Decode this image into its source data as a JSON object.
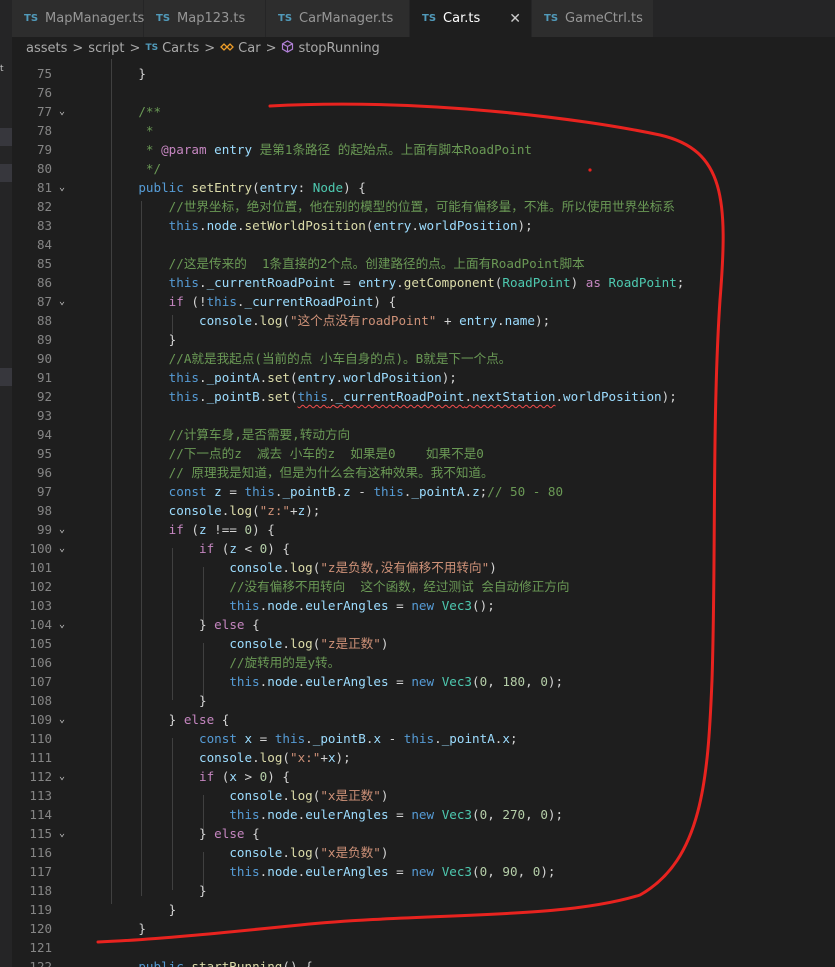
{
  "tabs": [
    {
      "badge": "TS",
      "name": "MapManager.ts"
    },
    {
      "badge": "TS",
      "name": "Map123.ts"
    },
    {
      "badge": "TS",
      "name": "CarManager.ts"
    },
    {
      "badge": "TS",
      "name": "Car.ts",
      "close": "✕"
    },
    {
      "badge": "TS",
      "name": "GameCtrl.ts"
    }
  ],
  "sidebar_letter": "t",
  "breadcrumb": {
    "folder1": "assets",
    "folder2": "script",
    "badge": "TS",
    "file": "Car.ts",
    "class_icon": "class-icon",
    "class": "Car",
    "method_icon": "method-icon",
    "method": "stopRunning",
    "separator": ">"
  },
  "lines": [
    {
      "n": "75",
      "fold": "",
      "tokens": [
        [
          "",
          "    }"
        ]
      ]
    },
    {
      "n": "76",
      "fold": "",
      "tokens": [
        [
          "",
          ""
        ]
      ]
    },
    {
      "n": "77",
      "fold": "⌄",
      "tokens": [
        [
          "cm",
          "    /**"
        ]
      ]
    },
    {
      "n": "78",
      "fold": "",
      "tokens": [
        [
          "cm",
          "     *"
        ]
      ]
    },
    {
      "n": "79",
      "fold": "",
      "tokens": [
        [
          "cm",
          "     * "
        ],
        [
          "ctl",
          "@param"
        ],
        [
          "cm",
          " "
        ],
        [
          "pr",
          "entry"
        ],
        [
          "cm",
          " 是第1条路径 的起始点。上面有脚本RoadPoint"
        ]
      ]
    },
    {
      "n": "80",
      "fold": "",
      "tokens": [
        [
          "cm",
          "     */"
        ]
      ]
    },
    {
      "n": "81",
      "fold": "⌄",
      "tokens": [
        [
          "kw",
          "    public "
        ],
        [
          "fn",
          "setEntry"
        ],
        [
          "",
          "("
        ],
        [
          "pr",
          "entry"
        ],
        [
          "",
          ": "
        ],
        [
          "ty",
          "Node"
        ],
        [
          "",
          ") {"
        ]
      ]
    },
    {
      "n": "82",
      "fold": "",
      "tokens": [
        [
          "cm",
          "        //世界坐标，绝对位置，他在别的模型的位置，可能有偏移量，不准。所以使用世界坐标系"
        ]
      ]
    },
    {
      "n": "83",
      "fold": "",
      "tokens": [
        [
          "kw",
          "        this"
        ],
        [
          "",
          "."
        ],
        [
          "pr",
          "node"
        ],
        [
          "",
          "."
        ],
        [
          "fn",
          "setWorldPosition"
        ],
        [
          "",
          "("
        ],
        [
          "pr",
          "entry"
        ],
        [
          "",
          "."
        ],
        [
          "pr",
          "worldPosition"
        ],
        [
          "",
          ");"
        ]
      ]
    },
    {
      "n": "84",
      "fold": "",
      "tokens": [
        [
          "",
          ""
        ]
      ]
    },
    {
      "n": "85",
      "fold": "",
      "tokens": [
        [
          "cm",
          "        //这是传来的  1条直接的2个点。创建路径的点。上面有RoadPoint脚本"
        ]
      ]
    },
    {
      "n": "86",
      "fold": "",
      "tokens": [
        [
          "kw",
          "        this"
        ],
        [
          "",
          "."
        ],
        [
          "pr",
          "_currentRoadPoint"
        ],
        [
          "",
          " = "
        ],
        [
          "pr",
          "entry"
        ],
        [
          "",
          "."
        ],
        [
          "fn",
          "getComponent"
        ],
        [
          "",
          "("
        ],
        [
          "ty",
          "RoadPoint"
        ],
        [
          "",
          ") "
        ],
        [
          "ctl",
          "as"
        ],
        [
          "",
          " "
        ],
        [
          "ty",
          "RoadPoint"
        ],
        [
          "",
          ";"
        ]
      ]
    },
    {
      "n": "87",
      "fold": "⌄",
      "tokens": [
        [
          "ctl",
          "        if"
        ],
        [
          "",
          " (!"
        ],
        [
          "kw",
          "this"
        ],
        [
          "",
          "."
        ],
        [
          "pr",
          "_currentRoadPoint"
        ],
        [
          "",
          ") {"
        ]
      ]
    },
    {
      "n": "88",
      "fold": "",
      "tokens": [
        [
          "pr",
          "            console"
        ],
        [
          "",
          "."
        ],
        [
          "fn",
          "log"
        ],
        [
          "",
          "("
        ],
        [
          "st",
          "\"这个点没有roadPoint\""
        ],
        [
          "",
          " + "
        ],
        [
          "pr",
          "entry"
        ],
        [
          "",
          "."
        ],
        [
          "pr",
          "name"
        ],
        [
          "",
          ");"
        ]
      ]
    },
    {
      "n": "89",
      "fold": "",
      "tokens": [
        [
          "",
          "        }"
        ]
      ]
    },
    {
      "n": "90",
      "fold": "",
      "tokens": [
        [
          "cm",
          "        //A就是我起点(当前的点 小车自身的点)。B就是下一个点。"
        ]
      ]
    },
    {
      "n": "91",
      "fold": "",
      "tokens": [
        [
          "kw",
          "        this"
        ],
        [
          "",
          "."
        ],
        [
          "pr",
          "_pointA"
        ],
        [
          "",
          "."
        ],
        [
          "fn",
          "set"
        ],
        [
          "",
          "("
        ],
        [
          "pr",
          "entry"
        ],
        [
          "",
          "."
        ],
        [
          "pr",
          "worldPosition"
        ],
        [
          "",
          ");"
        ]
      ]
    },
    {
      "n": "92",
      "fold": "",
      "tokens": [
        [
          "kw",
          "        this"
        ],
        [
          "",
          "."
        ],
        [
          "pr",
          "_pointB"
        ],
        [
          "",
          "."
        ],
        [
          "fn",
          "set"
        ],
        [
          "",
          "("
        ],
        [
          "kw",
          "this",
          "squig"
        ],
        [
          "",
          ".",
          "squig"
        ],
        [
          "pr",
          "_currentRoadPoint",
          "squig"
        ],
        [
          "",
          ".",
          "squig"
        ],
        [
          "pr",
          "nextStation",
          "squig"
        ],
        [
          "",
          "."
        ],
        [
          "pr",
          "worldPosition"
        ],
        [
          "",
          ");"
        ]
      ]
    },
    {
      "n": "93",
      "fold": "",
      "tokens": [
        [
          "",
          ""
        ]
      ]
    },
    {
      "n": "94",
      "fold": "",
      "tokens": [
        [
          "cm",
          "        //计算车身,是否需要,转动方向"
        ]
      ]
    },
    {
      "n": "95",
      "fold": "",
      "tokens": [
        [
          "cm",
          "        //下一点的z  减去 小车的z  如果是0    如果不是0"
        ]
      ]
    },
    {
      "n": "96",
      "fold": "",
      "tokens": [
        [
          "cm",
          "        // 原理我是知道，但是为什么会有这种效果。我不知道。"
        ]
      ]
    },
    {
      "n": "97",
      "fold": "",
      "tokens": [
        [
          "kw",
          "        const "
        ],
        [
          "pr",
          "z"
        ],
        [
          "",
          " = "
        ],
        [
          "kw",
          "this"
        ],
        [
          "",
          "."
        ],
        [
          "pr",
          "_pointB"
        ],
        [
          "",
          "."
        ],
        [
          "pr",
          "z"
        ],
        [
          "",
          " - "
        ],
        [
          "kw",
          "this"
        ],
        [
          "",
          "."
        ],
        [
          "pr",
          "_pointA"
        ],
        [
          "",
          "."
        ],
        [
          "pr",
          "z"
        ],
        [
          "",
          ";"
        ],
        [
          "cm",
          "// 50 - 80"
        ]
      ]
    },
    {
      "n": "98",
      "fold": "",
      "tokens": [
        [
          "pr",
          "        console"
        ],
        [
          "",
          "."
        ],
        [
          "fn",
          "log"
        ],
        [
          "",
          "("
        ],
        [
          "st",
          "\"z:\""
        ],
        [
          "",
          "+"
        ],
        [
          "pr",
          "z"
        ],
        [
          "",
          ");"
        ]
      ]
    },
    {
      "n": "99",
      "fold": "⌄",
      "tokens": [
        [
          "ctl",
          "        if"
        ],
        [
          "",
          " ("
        ],
        [
          "pr",
          "z"
        ],
        [
          "",
          " !== "
        ],
        [
          "nu",
          "0"
        ],
        [
          "",
          ") {"
        ]
      ]
    },
    {
      "n": "100",
      "fold": "⌄",
      "tokens": [
        [
          "ctl",
          "            if"
        ],
        [
          "",
          " ("
        ],
        [
          "pr",
          "z"
        ],
        [
          "",
          " < "
        ],
        [
          "nu",
          "0"
        ],
        [
          "",
          ") {"
        ]
      ]
    },
    {
      "n": "101",
      "fold": "",
      "tokens": [
        [
          "pr",
          "                console"
        ],
        [
          "",
          "."
        ],
        [
          "fn",
          "log"
        ],
        [
          "",
          "("
        ],
        [
          "st",
          "\"z是负数,没有偏移不用转向\""
        ],
        [
          "",
          ")"
        ]
      ]
    },
    {
      "n": "102",
      "fold": "",
      "tokens": [
        [
          "cm",
          "                //没有偏移不用转向  这个函数，经过测试 会自动修正方向"
        ]
      ]
    },
    {
      "n": "103",
      "fold": "",
      "tokens": [
        [
          "kw",
          "                this"
        ],
        [
          "",
          "."
        ],
        [
          "pr",
          "node"
        ],
        [
          "",
          "."
        ],
        [
          "pr",
          "eulerAngles"
        ],
        [
          "",
          " = "
        ],
        [
          "kw",
          "new "
        ],
        [
          "ty",
          "Vec3"
        ],
        [
          "",
          "();"
        ]
      ]
    },
    {
      "n": "104",
      "fold": "⌄",
      "tokens": [
        [
          "",
          "            } "
        ],
        [
          "ctl",
          "else"
        ],
        [
          "",
          " {"
        ]
      ]
    },
    {
      "n": "105",
      "fold": "",
      "tokens": [
        [
          "pr",
          "                console"
        ],
        [
          "",
          "."
        ],
        [
          "fn",
          "log"
        ],
        [
          "",
          "("
        ],
        [
          "st",
          "\"z是正数\""
        ],
        [
          "",
          ")"
        ]
      ]
    },
    {
      "n": "106",
      "fold": "",
      "tokens": [
        [
          "cm",
          "                //旋转用的是y转。"
        ]
      ]
    },
    {
      "n": "107",
      "fold": "",
      "tokens": [
        [
          "kw",
          "                this"
        ],
        [
          "",
          "."
        ],
        [
          "pr",
          "node"
        ],
        [
          "",
          "."
        ],
        [
          "pr",
          "eulerAngles"
        ],
        [
          "",
          " = "
        ],
        [
          "kw",
          "new "
        ],
        [
          "ty",
          "Vec3"
        ],
        [
          "",
          "("
        ],
        [
          "nu",
          "0"
        ],
        [
          "",
          ", "
        ],
        [
          "nu",
          "180"
        ],
        [
          "",
          ", "
        ],
        [
          "nu",
          "0"
        ],
        [
          "",
          ");"
        ]
      ]
    },
    {
      "n": "108",
      "fold": "",
      "tokens": [
        [
          "",
          "            }"
        ]
      ]
    },
    {
      "n": "109",
      "fold": "⌄",
      "tokens": [
        [
          "",
          "        } "
        ],
        [
          "ctl",
          "else"
        ],
        [
          "",
          " {"
        ]
      ]
    },
    {
      "n": "110",
      "fold": "",
      "tokens": [
        [
          "kw",
          "            const "
        ],
        [
          "pr",
          "x"
        ],
        [
          "",
          " = "
        ],
        [
          "kw",
          "this"
        ],
        [
          "",
          "."
        ],
        [
          "pr",
          "_pointB"
        ],
        [
          "",
          "."
        ],
        [
          "pr",
          "x"
        ],
        [
          "",
          " - "
        ],
        [
          "kw",
          "this"
        ],
        [
          "",
          "."
        ],
        [
          "pr",
          "_pointA"
        ],
        [
          "",
          "."
        ],
        [
          "pr",
          "x"
        ],
        [
          "",
          ";"
        ]
      ]
    },
    {
      "n": "111",
      "fold": "",
      "tokens": [
        [
          "pr",
          "            console"
        ],
        [
          "",
          "."
        ],
        [
          "fn",
          "log"
        ],
        [
          "",
          "("
        ],
        [
          "st",
          "\"x:\""
        ],
        [
          "",
          "+"
        ],
        [
          "pr",
          "x"
        ],
        [
          "",
          ");"
        ]
      ]
    },
    {
      "n": "112",
      "fold": "⌄",
      "tokens": [
        [
          "ctl",
          "            if"
        ],
        [
          "",
          " ("
        ],
        [
          "pr",
          "x"
        ],
        [
          "",
          " > "
        ],
        [
          "nu",
          "0"
        ],
        [
          "",
          ") {"
        ]
      ]
    },
    {
      "n": "113",
      "fold": "",
      "tokens": [
        [
          "pr",
          "                console"
        ],
        [
          "",
          "."
        ],
        [
          "fn",
          "log"
        ],
        [
          "",
          "("
        ],
        [
          "st",
          "\"x是正数\""
        ],
        [
          "",
          ")"
        ]
      ]
    },
    {
      "n": "114",
      "fold": "",
      "tokens": [
        [
          "kw",
          "                this"
        ],
        [
          "",
          "."
        ],
        [
          "pr",
          "node"
        ],
        [
          "",
          "."
        ],
        [
          "pr",
          "eulerAngles"
        ],
        [
          "",
          " = "
        ],
        [
          "kw",
          "new "
        ],
        [
          "ty",
          "Vec3"
        ],
        [
          "",
          "("
        ],
        [
          "nu",
          "0"
        ],
        [
          "",
          ", "
        ],
        [
          "nu",
          "270"
        ],
        [
          "",
          ", "
        ],
        [
          "nu",
          "0"
        ],
        [
          "",
          ");"
        ]
      ]
    },
    {
      "n": "115",
      "fold": "⌄",
      "tokens": [
        [
          "",
          "            } "
        ],
        [
          "ctl",
          "else"
        ],
        [
          "",
          " {"
        ]
      ]
    },
    {
      "n": "116",
      "fold": "",
      "tokens": [
        [
          "pr",
          "                console"
        ],
        [
          "",
          "."
        ],
        [
          "fn",
          "log"
        ],
        [
          "",
          "("
        ],
        [
          "st",
          "\"x是负数\""
        ],
        [
          "",
          ")"
        ]
      ]
    },
    {
      "n": "117",
      "fold": "",
      "tokens": [
        [
          "kw",
          "                this"
        ],
        [
          "",
          "."
        ],
        [
          "pr",
          "node"
        ],
        [
          "",
          "."
        ],
        [
          "pr",
          "eulerAngles"
        ],
        [
          "",
          " = "
        ],
        [
          "kw",
          "new "
        ],
        [
          "ty",
          "Vec3"
        ],
        [
          "",
          "("
        ],
        [
          "nu",
          "0"
        ],
        [
          "",
          ", "
        ],
        [
          "nu",
          "90"
        ],
        [
          "",
          ", "
        ],
        [
          "nu",
          "0"
        ],
        [
          "",
          ");"
        ]
      ]
    },
    {
      "n": "118",
      "fold": "",
      "tokens": [
        [
          "",
          "            }"
        ]
      ]
    },
    {
      "n": "119",
      "fold": "",
      "tokens": [
        [
          "",
          "        }"
        ]
      ]
    },
    {
      "n": "120",
      "fold": "",
      "tokens": [
        [
          "",
          "    }"
        ]
      ]
    },
    {
      "n": "121",
      "fold": "",
      "tokens": [
        [
          "",
          ""
        ]
      ]
    },
    {
      "n": "122",
      "fold": "",
      "tokens": [
        [
          "kw",
          "    public "
        ],
        [
          "fn",
          "startRunning"
        ],
        [
          "",
          "() {"
        ]
      ]
    }
  ],
  "colors": {
    "annotation": "#e8231f",
    "keyword": "#569cd6",
    "control": "#c586c0",
    "function": "#dcdcaa",
    "type": "#4ec9b0",
    "string": "#ce9178",
    "comment": "#6a9955"
  }
}
